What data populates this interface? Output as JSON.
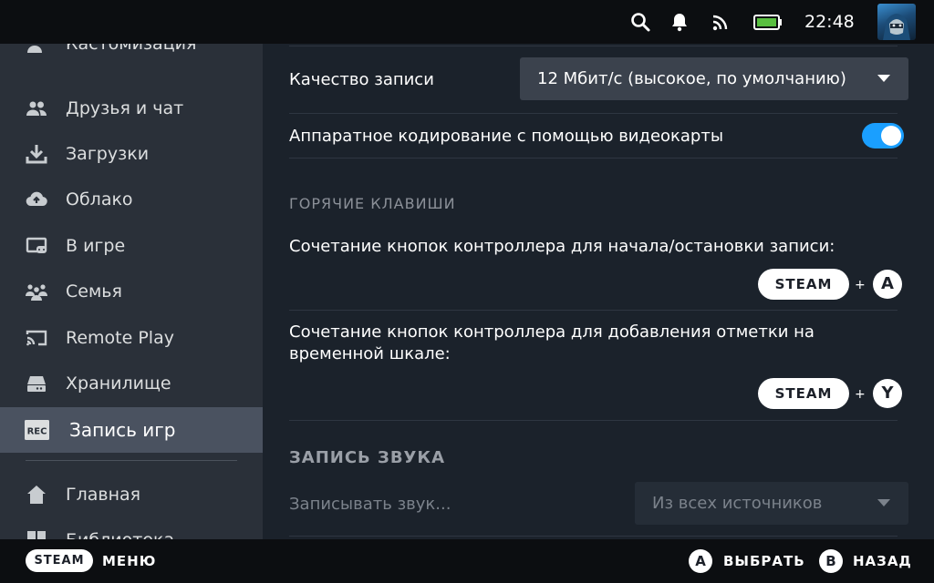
{
  "status_bar": {
    "time": "22:48",
    "icons": [
      "search-icon",
      "bell-icon",
      "wifi-icon",
      "battery-icon"
    ]
  },
  "sidebar": {
    "items": [
      {
        "label": "Кастомизация",
        "icon": "person-sparkle-icon"
      },
      {
        "label": "Друзья и чат",
        "icon": "friends-icon"
      },
      {
        "label": "Загрузки",
        "icon": "download-icon"
      },
      {
        "label": "Облако",
        "icon": "cloud-icon"
      },
      {
        "label": "В игре",
        "icon": "in-game-icon"
      },
      {
        "label": "Семья",
        "icon": "family-icon"
      },
      {
        "label": "Remote Play",
        "icon": "cast-icon"
      },
      {
        "label": "Хранилище",
        "icon": "storage-icon"
      },
      {
        "label": "Запись игр",
        "icon": "rec-icon",
        "badge": "REC",
        "active": true
      },
      {
        "label": "Главная",
        "icon": "home-icon"
      },
      {
        "label": "Библиотека",
        "icon": "library-icon"
      }
    ]
  },
  "main": {
    "quality": {
      "label": "Качество записи",
      "value": "12 Мбит/с (высокое, по умолчанию)"
    },
    "hw_encoding": {
      "label": "Аппаратное кодирование с помощью видеокарты",
      "enabled": true
    },
    "hotkeys": {
      "heading": "ГОРЯЧИЕ КЛАВИШИ",
      "start_stop_label": "Сочетание кнопок контроллера для начала/остановки записи:",
      "start_stop_combo": {
        "steam": "STEAM",
        "plus": "+",
        "button": "A"
      },
      "marker_label_line1": "Сочетание кнопок контроллера для добавления отметки на",
      "marker_label_line2": "временной шкале:",
      "marker_combo": {
        "steam": "STEAM",
        "plus": "+",
        "button": "Y"
      }
    },
    "audio": {
      "heading": "ЗАПИСЬ ЗВУКА",
      "record_label": "Записывать звук...",
      "record_value": "Из всех источников"
    }
  },
  "bottom_bar": {
    "steam": "STEAM",
    "menu": "МЕНЮ",
    "a_button": "A",
    "select": "ВЫБРАТЬ",
    "b_button": "B",
    "back": "НАЗАД"
  },
  "colors": {
    "accent": "#1a9fff",
    "sidebar_bg": "#2a3039",
    "main_bg": "#1b222b",
    "active_item_bg": "#4a5260"
  }
}
